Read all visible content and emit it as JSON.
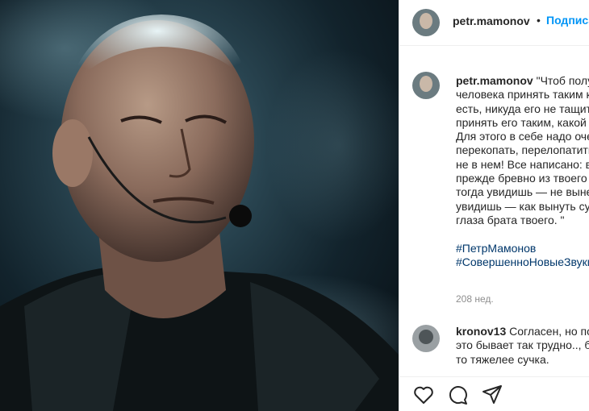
{
  "post": {
    "username": "petr.mamonov",
    "follow_label": "Подписаться",
    "separator": "•"
  },
  "caption": {
    "username": "petr.mamonov",
    "lines": [
      "\"Чтоб получить",
      "человека принять таким как он",
      "есть, никуда его не тащить, а",
      "принять его таким, какой он есть.",
      "Для этого в себе надо очень много",
      "перекопать, перелопатить. Дело",
      "не в нем! Все написано: вынь",
      "прежде бревно из твоего глаза,",
      "тогда увидишь — не вынешь, не",
      "увидишь — как вынуть сучок из",
      "глаза брата твоего. \""
    ],
    "hashtags": [
      "#ПетрМамонов",
      "#СовершенноНовыеЗвуки"
    ],
    "time": "208 нед."
  },
  "comment": {
    "username": "kronov13",
    "lines": [
      "Согласен, но порой",
      "это бывает так трудно.., бывает",
      "то тяжелее сучка."
    ]
  },
  "icons": {
    "like": "heart-icon",
    "comment": "comment-icon",
    "share": "paper-plane-icon"
  },
  "colors": {
    "link": "#00376b",
    "follow": "#0095f6",
    "muted": "#8e8e8e",
    "text": "#262626"
  }
}
